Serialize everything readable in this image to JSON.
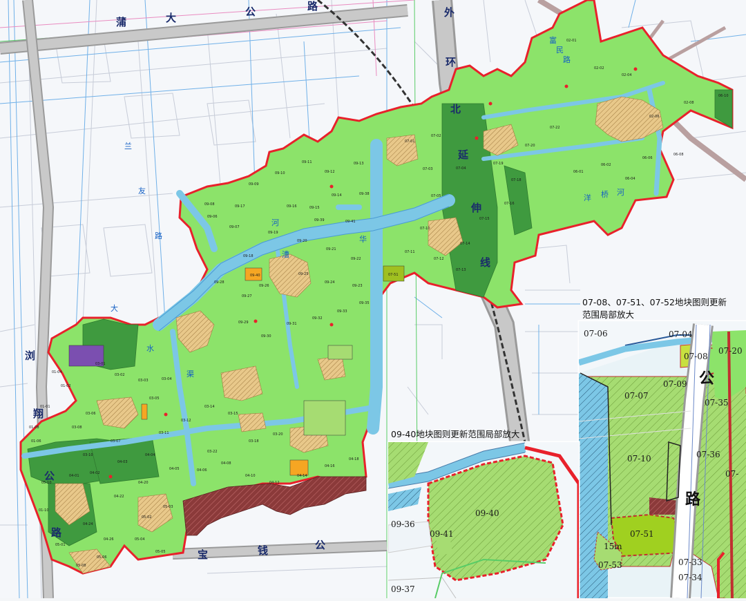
{
  "colors": {
    "plan_green": "#8ce36a",
    "dark_green": "#3f9a3f",
    "residential": "#e8c88a",
    "water": "#7cc7e6",
    "industrial": "#8b3a3a",
    "boundary": "#e8212b",
    "purple": "#7b4fb0"
  },
  "roads": {
    "top_chars": [
      "蒲",
      "大",
      "公",
      "路"
    ],
    "outer_ring_chars": [
      "外",
      "环",
      "北",
      "延",
      "伸",
      "线"
    ],
    "bottom_chars": [
      "宝",
      "钱",
      "公"
    ],
    "left_chars": [
      "浏",
      "翔",
      "公",
      "路"
    ],
    "inset_right_chars": [
      "公",
      "路"
    ],
    "small_road_chars": [
      "兰",
      "友",
      "路"
    ],
    "plant_road_chars": [
      "富",
      "民",
      "路"
    ]
  },
  "water": {
    "river_chars": [
      "华",
      "漕",
      "河"
    ],
    "east_river_chars": [
      "洋",
      "桥",
      "河"
    ],
    "misc_chars": [
      "大",
      "水",
      "渠"
    ]
  },
  "parcels": [
    "09-06",
    "09-07",
    "09-08",
    "09-09",
    "09-10",
    "09-11",
    "09-12",
    "09-13",
    "09-14",
    "09-15",
    "09-16",
    "09-17",
    "09-18",
    "09-19",
    "09-20",
    "09-21",
    "09-22",
    "09-23",
    "09-24",
    "09-25",
    "09-26",
    "09-27",
    "09-28",
    "09-29",
    "09-30",
    "09-31",
    "09-32",
    "09-33",
    "09-35",
    "09-38",
    "09-39",
    "09-41",
    "07-01",
    "07-02",
    "07-03",
    "07-04",
    "07-05",
    "07-10",
    "07-11",
    "07-12",
    "07-13",
    "07-14",
    "07-15",
    "07-16",
    "07-18",
    "07-19",
    "07-20",
    "07-22",
    "03-01",
    "03-02",
    "03-03",
    "03-04",
    "03-05",
    "03-06",
    "03-07",
    "03-08",
    "03-10",
    "03-11",
    "03-12",
    "03-14",
    "03-15",
    "03-18",
    "03-20",
    "03-22",
    "04-01",
    "04-02",
    "04-03",
    "04-04",
    "04-05",
    "04-06",
    "04-08",
    "04-10",
    "04-12",
    "04-14",
    "04-16",
    "04-18",
    "04-20",
    "04-22",
    "04-24",
    "04-26",
    "05-01",
    "05-02",
    "05-03",
    "05-04",
    "05-05",
    "05-06",
    "05-08",
    "05-10",
    "01-01",
    "01-02",
    "01-04",
    "01-06",
    "01-08",
    "01-10",
    "02-01",
    "02-02",
    "02-04",
    "02-06",
    "02-08",
    "06-01",
    "06-02",
    "06-04",
    "06-06",
    "06-08",
    "06-10"
  ],
  "special_parcels": {
    "p0940_small": "09-40",
    "p0751_small": "07-51"
  },
  "inset_right": {
    "title_line1": "07-08、07-51、07-52地块图则更新",
    "title_line2": "范围局部放大",
    "labels": [
      "07-06",
      "07-04",
      "07-08",
      "07-20",
      "07-09",
      "07-07",
      "07-35",
      "07-10",
      "07-36",
      "07-51",
      "07-33",
      "07-34",
      "07-53"
    ],
    "setback_note": "15m",
    "extra_label": "07-"
  },
  "inset_bottom": {
    "title": "09-40地块图则更新范围局部放大",
    "labels": [
      "09-36",
      "09-40",
      "09-41",
      "09-37"
    ]
  }
}
